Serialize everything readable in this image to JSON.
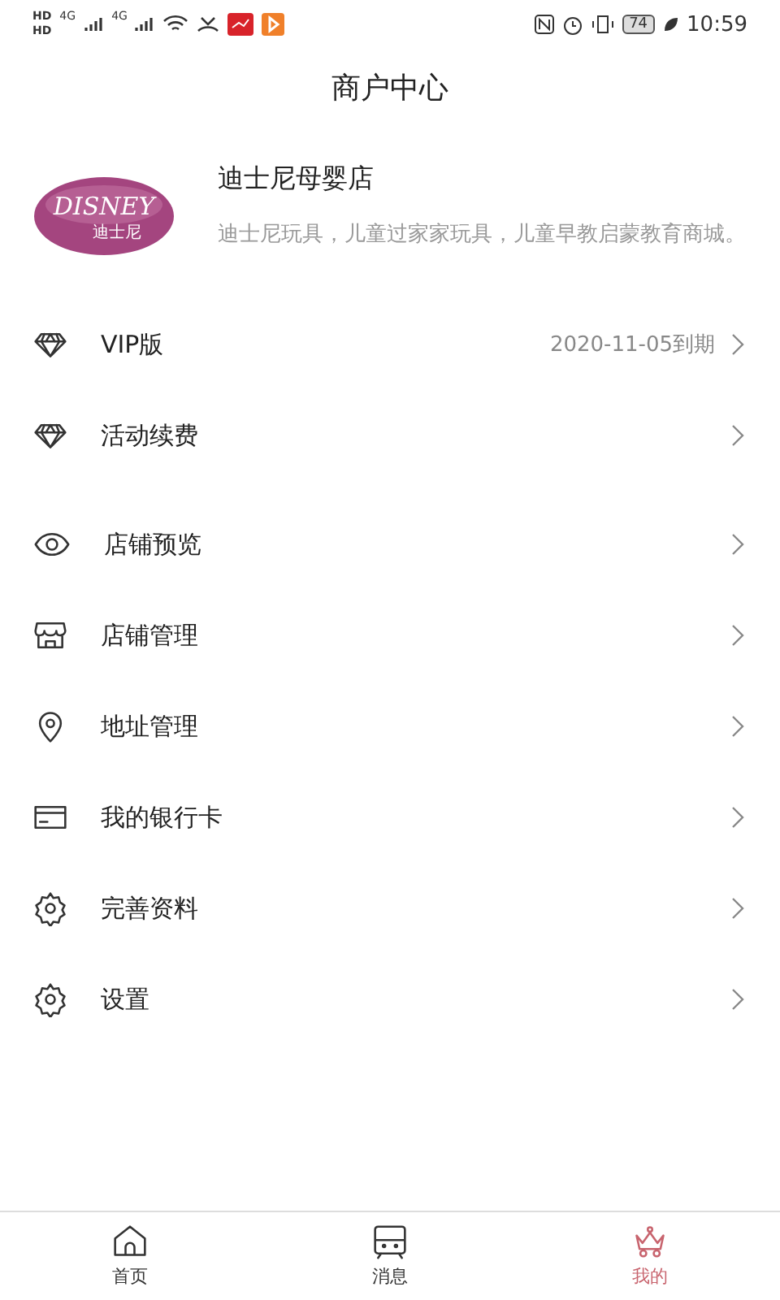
{
  "status_bar": {
    "hd_labels": [
      "HD",
      "HD"
    ],
    "network_labels": [
      "4G",
      "4G"
    ],
    "battery": "74",
    "time": "10:59"
  },
  "header": {
    "title": "商户中心"
  },
  "store": {
    "logo": {
      "wordmark": "DISNEY",
      "subtitle": "迪士尼"
    },
    "name": "迪士尼母婴店",
    "description": "迪士尼玩具，儿童过家家玩具，儿童早教启蒙教育商城。"
  },
  "menu_groups": [
    {
      "items": [
        {
          "kind": "diamond",
          "label": "VIP版",
          "value": "2020-11-05到期"
        },
        {
          "kind": "diamond",
          "label": "活动续费"
        }
      ]
    },
    {
      "items": [
        {
          "kind": "eye",
          "label": "店铺预览"
        },
        {
          "kind": "shop",
          "label": "店铺管理"
        },
        {
          "kind": "location",
          "label": "地址管理"
        },
        {
          "kind": "card",
          "label": "我的银行卡"
        },
        {
          "kind": "gear",
          "label": "完善资料"
        },
        {
          "kind": "gear",
          "label": "设置"
        }
      ]
    }
  ],
  "bottom_nav": [
    {
      "kind": "home",
      "label": "首页",
      "selected": false
    },
    {
      "kind": "message",
      "label": "消息",
      "selected": false
    },
    {
      "kind": "crown",
      "label": "我的",
      "selected": true
    }
  ]
}
